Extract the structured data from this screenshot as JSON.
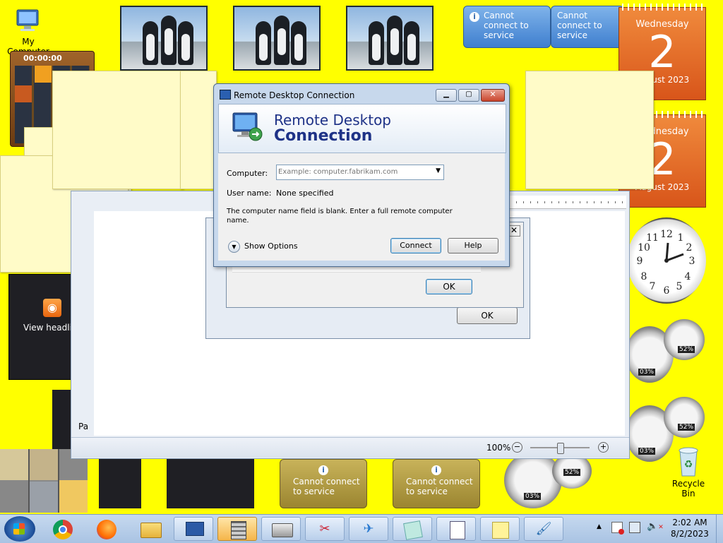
{
  "desktop": {
    "my_computer_label": "My Computer",
    "recycle_bin_label": "Recycle Bin",
    "timer_display": "00:00:00",
    "feed_label": "View headli",
    "page_fragment": "Pa"
  },
  "gadgets": {
    "cannot_connect": "Cannot connect to service",
    "calendar_top": {
      "day": "Wednesday",
      "date": "2",
      "month_year": "August 2023"
    },
    "calendar_bottom": {
      "day": "Wednesday",
      "date": "2",
      "month_year": "August 2023"
    },
    "meter_1_cpu": "03%",
    "meter_1_mem": "52%",
    "meter_2_cpu": "03%",
    "meter_2_mem": "52%",
    "meter_3_cpu": "03%",
    "meter_3_mem": "52%"
  },
  "rdc_dialog": {
    "title": "Remote Desktop Connection",
    "header_line1": "Remote Desktop",
    "header_line2": "Connection",
    "computer_label": "Computer:",
    "computer_placeholder": "Example: computer.fabrikam.com",
    "computer_value": "",
    "username_label": "User name:",
    "username_value": "None specified",
    "warning_text": "The computer name field is blank. Enter a full remote computer name.",
    "show_options_label": "Show Options",
    "connect_label": "Connect",
    "help_label": "Help"
  },
  "behind_dialog_1": {
    "ok_label": "OK"
  },
  "behind_dialog_2": {
    "ok_label": "OK"
  },
  "wordpad": {
    "zoom_level": "100%",
    "zoom_fraction": 0.5
  },
  "taskbar": {
    "time": "2:02 AM",
    "date": "8/2/2023",
    "buttons": [
      "start",
      "chrome",
      "firefox",
      "explorer",
      "remote-desktop",
      "calculator",
      "fax-scan",
      "snipping",
      "send-feedback",
      "sticky-notes",
      "wordpad",
      "sticky-notes-2",
      "paint"
    ]
  },
  "colors": {
    "desktop": "#ffff00",
    "dialog_title_text": "#1e3287",
    "calendar": "#e86a24"
  }
}
